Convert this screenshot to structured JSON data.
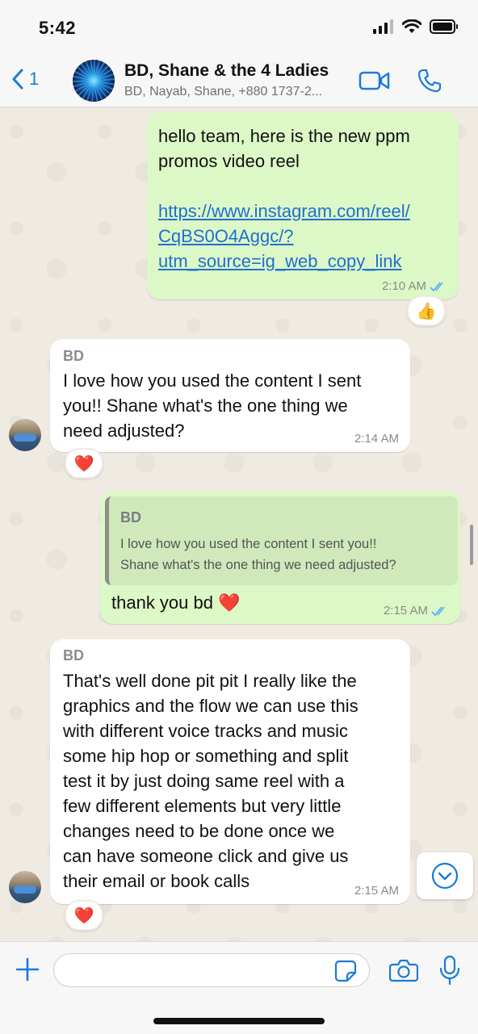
{
  "status_bar": {
    "time": "5:42"
  },
  "header": {
    "back_count": "1",
    "title": "BD, Shane & the 4 Ladies",
    "subtitle": "BD, Nayab, Shane, +880 1737-2..."
  },
  "messages": [
    {
      "direction": "outgoing",
      "line1": "hello team, here is the new ppm",
      "line2": "promos video reel",
      "link_lines": [
        "https://www.instagram.com/reel/",
        "CqBS0O4Aggc/?",
        "utm_source=ig_web_copy_link"
      ],
      "time": "2:10 AM",
      "reaction": "👍"
    },
    {
      "direction": "incoming",
      "sender": "BD",
      "lines": [
        "I love how you used the content I sent",
        "you!! Shane what's the one thing we",
        "need adjusted?"
      ],
      "time": "2:14 AM",
      "reaction": "❤️"
    },
    {
      "direction": "outgoing",
      "quote_sender": "BD",
      "quote_lines": [
        "I love how you used the content I sent you!!",
        "Shane what's the one thing we need adjusted?"
      ],
      "text": "thank you bd ❤️",
      "time": "2:15 AM"
    },
    {
      "direction": "incoming",
      "sender": "BD",
      "lines": [
        "That's well done pit pit I really like the",
        "graphics and the flow we can use this",
        "with different voice tracks and music",
        "some hip hop or something and split",
        "test it by just doing same reel with a",
        "few different elements but very little",
        "changes need to be done once we",
        "can have someone click and give us",
        "their email or book calls"
      ],
      "time": "2:15 AM",
      "reaction": "❤️"
    }
  ],
  "composer": {
    "placeholder": ""
  },
  "colors": {
    "accent": "#1a7ad9",
    "outgoing_bubble": "#dcf8c6",
    "incoming_bubble": "#ffffff",
    "read_ticks": "#4fb6ec"
  },
  "icons": [
    "back-chevron-icon",
    "video-call-icon",
    "phone-icon",
    "double-check-icon",
    "scroll-down-icon",
    "plus-icon",
    "sticker-icon",
    "camera-icon",
    "microphone-icon"
  ]
}
